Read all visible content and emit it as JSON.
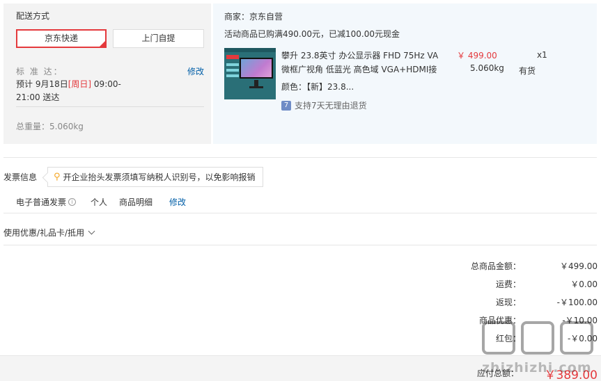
{
  "shipping": {
    "title": "配送方式",
    "options": [
      "京东快递",
      "上门自提"
    ],
    "selected": "京东快递",
    "standard_label": "标 准 达：",
    "modify": "修改",
    "delivery_prefix": "预计 9月18日",
    "delivery_weekday": "[周日]",
    "delivery_suffix": " 09:00-21:00 送达",
    "total_weight": "总重量：5.060kg"
  },
  "order": {
    "merchant": "商家：京东自营",
    "promo": "活动商品已购满490.00元，已减100.00元现金",
    "product": {
      "name": "攀升 23.8英寸 办公显示器 FHD 75Hz VA 微框广视角 低蓝光 高色域 VGA+HDMI接",
      "price": "￥ 499.00",
      "qty": "x1",
      "weight": "5.060kg",
      "stock": "有货",
      "color": "颜色：【新】23.8...",
      "return_policy": "支持7天无理由退货",
      "return_icon": "7"
    }
  },
  "invoice": {
    "title": "发票信息",
    "tip": "开企业抬头发票须填写纳税人识别号，以免影响报销",
    "type": "电子普通发票",
    "info_icon": "i",
    "person": "个人",
    "detail": "商品明细",
    "modify": "修改"
  },
  "coupon": {
    "label": "使用优惠/礼品卡/抵用"
  },
  "summary": {
    "rows": [
      {
        "label": "总商品金额：",
        "value": "￥499.00"
      },
      {
        "label": "运费：",
        "value": "￥0.00"
      },
      {
        "label": "返现：",
        "value": "-￥100.00"
      },
      {
        "label": "商品优惠：",
        "value": "-￥10.00"
      },
      {
        "label": "红包：",
        "value": "-￥0.00"
      }
    ],
    "payable_label": "应付总额：",
    "payable_value": "￥389.00"
  },
  "watermark": {
    "text": "zhizhizhi.com"
  },
  "colors": {
    "accent": "#e4393c",
    "link": "#005ea7"
  }
}
